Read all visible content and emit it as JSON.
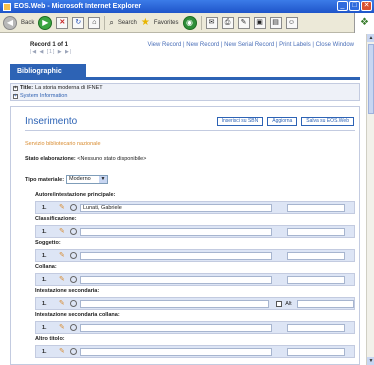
{
  "window": {
    "title": "EOS.Web - Microsoft Internet Explorer",
    "btn_min": "_",
    "btn_max": "□",
    "btn_close": "✕"
  },
  "toolbar": {
    "back_label": "Back",
    "search_label": "Search",
    "favorites_label": "Favorites"
  },
  "record": {
    "count": "Record 1 of 1",
    "nav": "|◀ ◀ [1] ▶ ▶|"
  },
  "top_links": "View Record | New Record | New Serial Record | Print Labels | Close Window",
  "tab": {
    "label": "Bibliographic"
  },
  "info": {
    "title_label": "Title:",
    "title_value": "La storia moderna di IFNET",
    "system_info": "System Information"
  },
  "form": {
    "title": "Inserimento",
    "btn_sbn": "Inserisci su SBN",
    "btn_update": "Aggiorna",
    "btn_save": "Salva su EOS.Web",
    "service": "Servizio bibliotecario nazionale",
    "stato_label": "Stato elaborazione:",
    "stato_value": "<Nessuno stato disponibile>",
    "tipo_label": "Tipo materiale:",
    "tipo_value": "Moderno"
  },
  "fields": [
    {
      "label": "Autore/intestazione principale:",
      "num": "1.",
      "value": "Lunati, Gabriele"
    },
    {
      "label": "Classificazione:",
      "num": "1.",
      "value": ""
    },
    {
      "label": "Soggetto:",
      "num": "1.",
      "value": ""
    },
    {
      "label": "Collana:",
      "num": "1.",
      "value": ""
    },
    {
      "label": "Intestazione secondaria:",
      "num": "1.",
      "value": "",
      "checkbox": "Alt"
    },
    {
      "label": "Intestazione secondaria collana:",
      "num": "1.",
      "value": ""
    },
    {
      "label": "Altro titolo:",
      "num": "1.",
      "value": ""
    }
  ]
}
